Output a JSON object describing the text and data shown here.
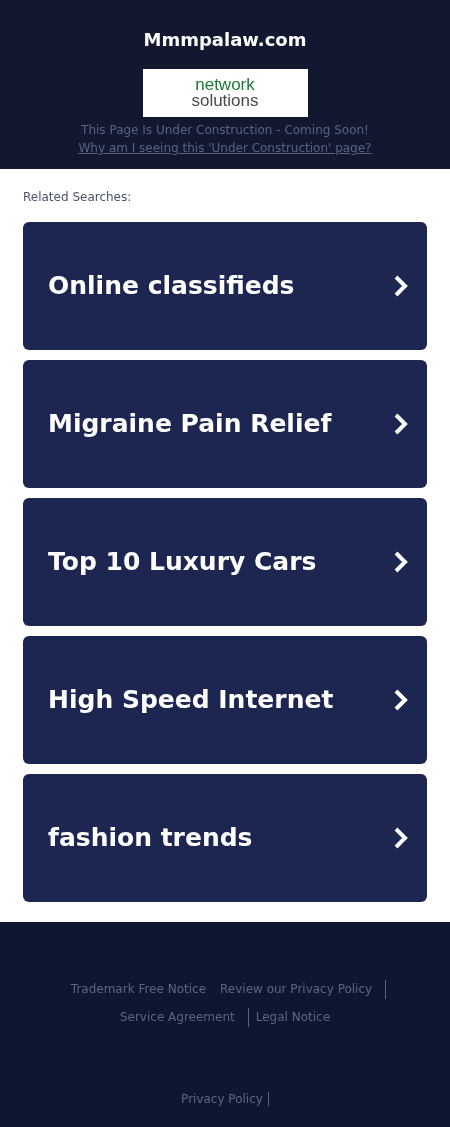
{
  "header": {
    "title": "Mmmpalaw.com",
    "logo": {
      "line1": "network",
      "line2": "solutions"
    },
    "notice": "This Page Is Under Construction - Coming Soon!",
    "why_link": "Why am I seeing this 'Under Construction' page?"
  },
  "related": {
    "heading": "Related Searches:",
    "items": [
      {
        "label": "Online classifieds"
      },
      {
        "label": "Migraine Pain Relief"
      },
      {
        "label": "Top 10 Luxury Cars"
      },
      {
        "label": "High Speed Internet"
      },
      {
        "label": "fashion trends"
      }
    ]
  },
  "footer": {
    "links": [
      {
        "label": "Trademark Free Notice",
        "divider": false
      },
      {
        "label": "Review our Privacy Policy",
        "divider": true
      },
      {
        "label": "Service Agreement",
        "divider": true
      },
      {
        "label": "Legal Notice",
        "divider": false
      }
    ],
    "bottom_links": [
      {
        "label": "Privacy Policy",
        "divider": true
      }
    ]
  }
}
